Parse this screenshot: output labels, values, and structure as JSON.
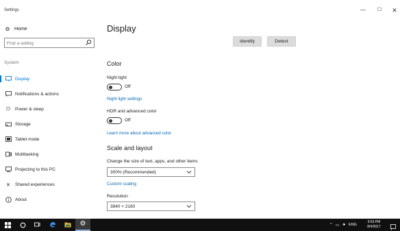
{
  "window": {
    "title": "Settings",
    "controls": {
      "minimize": "—",
      "maximize": "☐",
      "close": "✕"
    }
  },
  "sidebar": {
    "home": {
      "icon": "gear-icon",
      "label": "Home"
    },
    "search": {
      "placeholder": "Find a setting",
      "icon": "search-icon"
    },
    "section_label": "System",
    "items": [
      {
        "label": "Display",
        "icon": "monitor-icon",
        "active": true
      },
      {
        "label": "Notifications & actions",
        "icon": "notification-icon"
      },
      {
        "label": "Power & sleep",
        "icon": "power-icon"
      },
      {
        "label": "Storage",
        "icon": "storage-icon"
      },
      {
        "label": "Tablet mode",
        "icon": "tablet-icon"
      },
      {
        "label": "Multitasking",
        "icon": "multitasking-icon"
      },
      {
        "label": "Projecting to this PC",
        "icon": "projecting-icon"
      },
      {
        "label": "Shared experiences",
        "icon": "shared-experiences-icon"
      },
      {
        "label": "About",
        "icon": "info-icon"
      }
    ]
  },
  "main": {
    "title": "Display",
    "buttons": {
      "identify": "Identify",
      "detect": "Detect"
    },
    "color": {
      "heading": "Color",
      "night_light_label": "Night light",
      "night_light_state": "Off",
      "night_light_settings_link": "Night light settings",
      "hdr_label": "HDR and advanced color",
      "hdr_state": "Off",
      "hdr_link": "Learn more about advanced color"
    },
    "scale": {
      "heading": "Scale and layout",
      "size_label": "Change the size of text, apps, and other items",
      "size_value": "300% (Recommended)",
      "custom_scaling_link": "Custom scaling",
      "resolution_label": "Resolution",
      "resolution_value": "3840 × 2160"
    }
  },
  "taskbar": {
    "items": [
      "windows-start-icon",
      "cortana-icon",
      "task-view-icon",
      "edge-icon",
      "file-explorer-icon",
      "settings-icon"
    ],
    "tray": {
      "language": "ENG"
    },
    "clock": {
      "time": "9:53 PM",
      "date": "8/4/2017"
    }
  },
  "colors": {
    "accent": "#0078d7",
    "link": "#0067b8",
    "taskbar": "#101010"
  }
}
